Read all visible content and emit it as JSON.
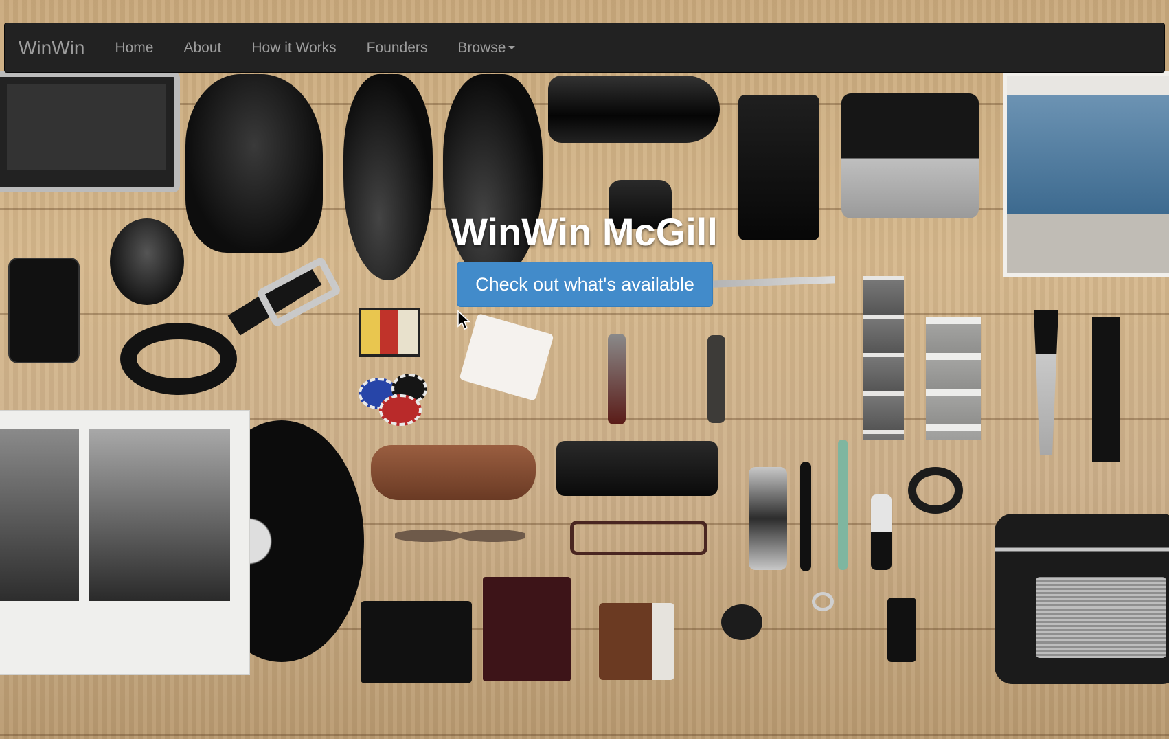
{
  "navbar": {
    "brand": "WinWin",
    "items": [
      {
        "label": "Home"
      },
      {
        "label": "About"
      },
      {
        "label": "How it Works"
      },
      {
        "label": "Founders"
      },
      {
        "label": "Browse",
        "has_dropdown": true
      }
    ]
  },
  "hero": {
    "title": "WinWin McGill",
    "cta_label": "Check out what's available"
  },
  "colors": {
    "navbar_bg": "#222222",
    "nav_text": "#9d9d9d",
    "button_bg": "#428bca",
    "title_text": "#ffffff"
  },
  "icons": {
    "cursor": "mouse-pointer-icon",
    "dropdown": "caret-down-icon"
  }
}
